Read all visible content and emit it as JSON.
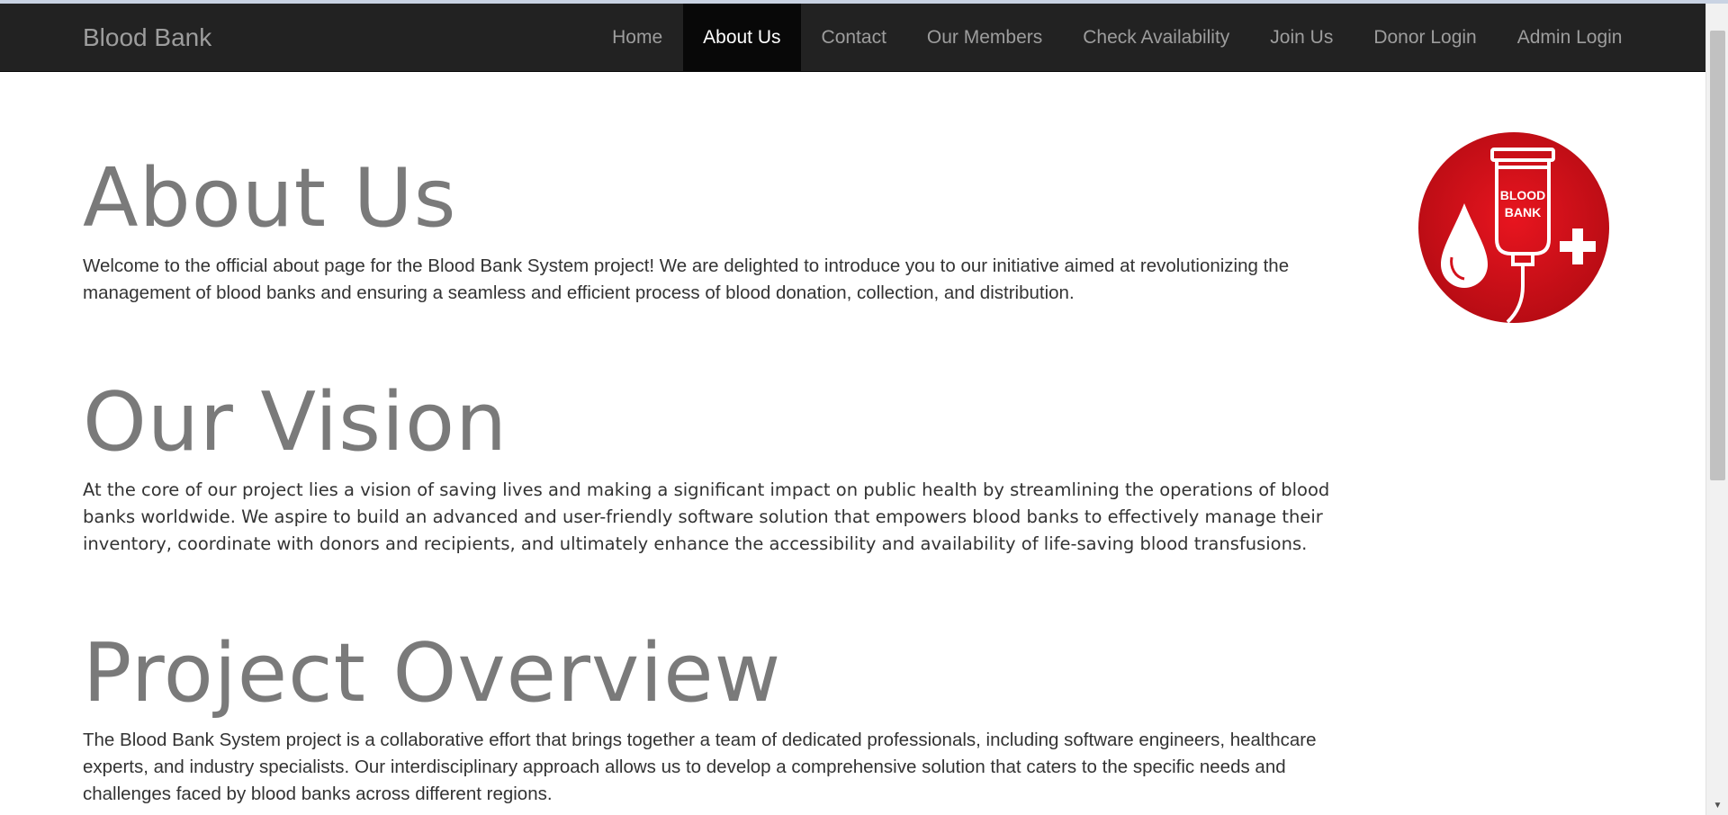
{
  "navbar": {
    "brand": "Blood Bank",
    "items": [
      {
        "label": "Home",
        "active": false
      },
      {
        "label": "About Us",
        "active": true
      },
      {
        "label": "Contact",
        "active": false
      },
      {
        "label": "Our Members",
        "active": false
      },
      {
        "label": "Check Availability",
        "active": false
      },
      {
        "label": "Join Us",
        "active": false
      },
      {
        "label": "Donor Login",
        "active": false
      },
      {
        "label": "Admin Login",
        "active": false
      }
    ]
  },
  "sections": {
    "about": {
      "title": "About Us",
      "text": "Welcome to the official about page for the Blood Bank System project! We are delighted to introduce you to our initiative aimed at revolutionizing the management of blood banks and ensuring a seamless and efficient process of blood donation, collection, and distribution."
    },
    "vision": {
      "title": "Our Vision",
      "text": "At the core of our project lies a vision of saving lives and making a significant impact on public health by streamlining the operations of blood banks worldwide. We aspire to build an advanced and user-friendly software solution that empowers blood banks to effectively manage their inventory, coordinate with donors and recipients, and ultimately enhance the accessibility and availability of life-saving blood transfusions."
    },
    "overview": {
      "title": "Project Overview",
      "text": "The Blood Bank System project is a collaborative effort that brings together a team of dedicated professionals, including software engineers, healthcare experts, and industry specialists. Our interdisciplinary approach allows us to develop a comprehensive solution that caters to the specific needs and challenges faced by blood banks across different regions."
    }
  },
  "logo": {
    "line1": "BLOOD",
    "line2": "BANK",
    "icon": "blood-bank-logo"
  },
  "colors": {
    "navbar_bg": "#222222",
    "navbar_active_bg": "#080808",
    "logo_red": "#d3111b",
    "heading_gray": "#7a7a7a"
  }
}
